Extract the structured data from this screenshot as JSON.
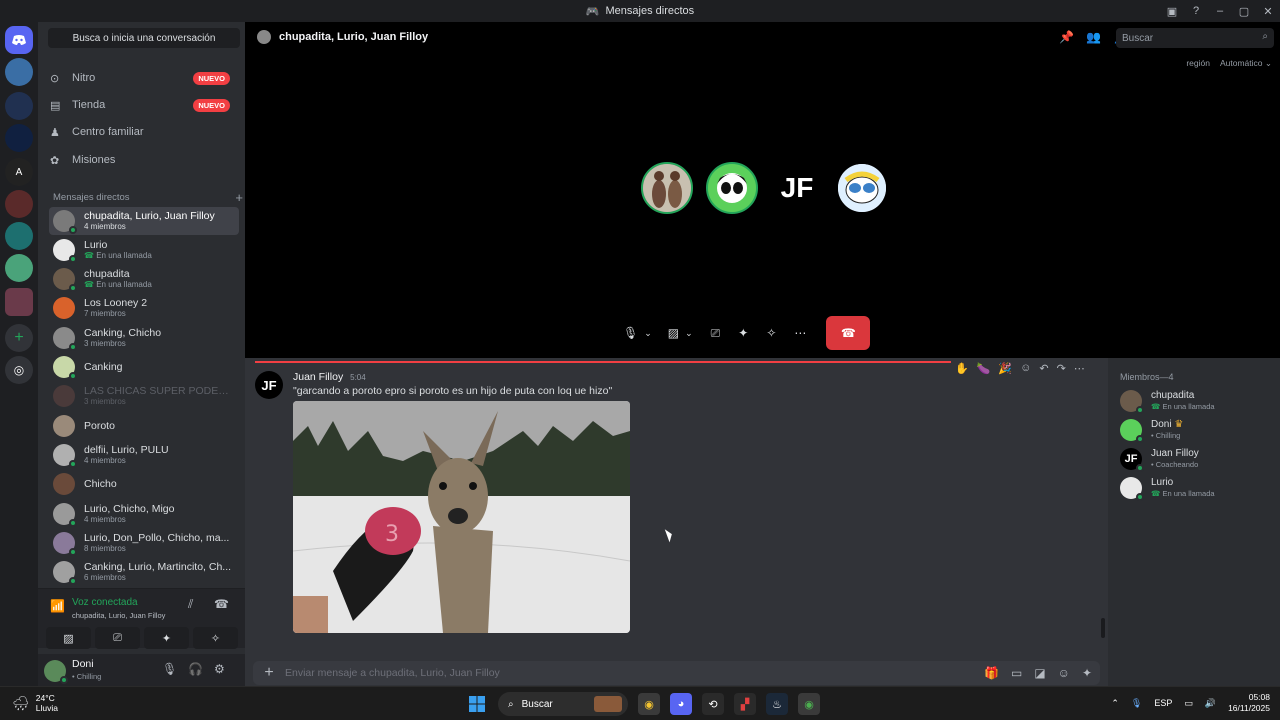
{
  "window": {
    "title": "Mensajes directos",
    "controls": [
      "□",
      "?",
      "–",
      "▢",
      "✕"
    ]
  },
  "sidebar": {
    "search_label": "Busca o inicia una conversación",
    "nav": [
      {
        "label": "Nitro",
        "badge": "NUEVO",
        "icon": "nitro-icon"
      },
      {
        "label": "Tienda",
        "badge": "NUEVO",
        "icon": "shop-icon"
      },
      {
        "label": "Centro familiar",
        "badge": "",
        "icon": "family-icon"
      },
      {
        "label": "Misiones",
        "badge": "",
        "icon": "quests-icon"
      }
    ],
    "dm_header": "Mensajes directos",
    "dms": [
      {
        "name": "chupadita, Lurio, Juan Filloy",
        "sub": "4 miembros"
      },
      {
        "name": "Lurio",
        "sub": "En una llamada"
      },
      {
        "name": "chupadita",
        "sub": "En una llamada"
      },
      {
        "name": "Los Looney 2",
        "sub": "7 miembros"
      },
      {
        "name": "Canking, Chicho",
        "sub": "3 miembros"
      },
      {
        "name": "Canking",
        "sub": ""
      },
      {
        "name": "LAS CHICAS SUPER PODERO...",
        "sub": "3 miembros"
      },
      {
        "name": "Poroto",
        "sub": ""
      },
      {
        "name": "delfii, Lurio, PULU",
        "sub": "4 miembros"
      },
      {
        "name": "Chicho",
        "sub": ""
      },
      {
        "name": "Lurio, Chicho, Migo",
        "sub": "4 miembros"
      },
      {
        "name": "Lurio, Don_Pollo, Chicho, ma...",
        "sub": "8 miembros"
      },
      {
        "name": "Canking, Lurio, Martincito, Ch...",
        "sub": "6 miembros"
      }
    ],
    "voice": {
      "status": "Voz conectada",
      "channel": "chupadita, Lurio, Juan Filloy"
    },
    "user": {
      "name": "Doni",
      "status": "• Chilling"
    }
  },
  "call": {
    "title": "chupadita, Lurio, Juan Filloy",
    "search_placeholder": "Buscar",
    "region_label": "región",
    "region_value": "Automático",
    "participant_initials": "JF"
  },
  "message": {
    "author": "Juan Filloy",
    "time": "5:04",
    "text": "\"garcando a poroto epro si poroto es un hijo de puta con loq ue hizo\"",
    "avatar_initials": "JF"
  },
  "composer": {
    "placeholder": "Enviar mensaje a chupadita, Lurio, Juan Filloy"
  },
  "members": {
    "header": "Miembros—4",
    "list": [
      {
        "name": "chupadita",
        "status": "En una llamada"
      },
      {
        "name": "Doni",
        "status": "• Chilling"
      },
      {
        "name": "Juan Filloy",
        "status": "• Coacheando"
      },
      {
        "name": "Lurio",
        "status": "En una llamada"
      }
    ]
  },
  "taskbar": {
    "weather_temp": "24°C",
    "weather_desc": "Lluvia",
    "search_label": "Buscar",
    "lang": "ESP",
    "time": "05:08",
    "date": "16/11/2025"
  }
}
